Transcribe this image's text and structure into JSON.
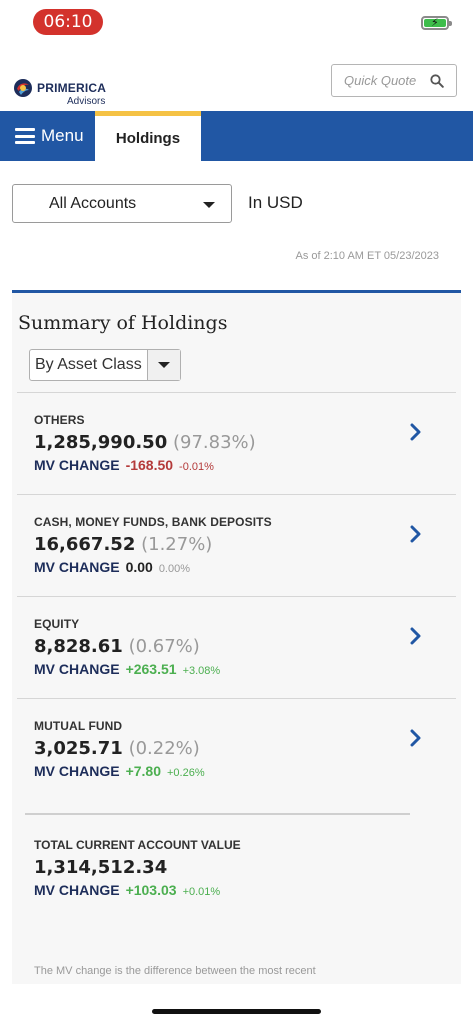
{
  "status": {
    "time": "06:10",
    "colors": {
      "time_pill": "#d3322c",
      "battery": "#3dbd4b"
    }
  },
  "header": {
    "logo_name": "PRIMERICA",
    "logo_sub": "Advisors",
    "quick_quote_placeholder": "Quick Quote"
  },
  "nav": {
    "menu_label": "Menu",
    "active_tab": "Holdings",
    "colors": {
      "bar": "#2157a4",
      "tab_accent": "#f5c245"
    }
  },
  "account": {
    "selected": "All Accounts",
    "currency": "In USD",
    "as_of": "As of  2:10 AM ET 05/23/2023"
  },
  "summary": {
    "title": "Summary of Holdings",
    "group_by": "By Asset Class",
    "holdings": [
      {
        "name": "OTHERS",
        "value": "1,285,990.50",
        "pct": "(97.83%)",
        "mv_label": "MV CHANGE",
        "mv_amount": "-168.50",
        "mv_pct": "-0.01%",
        "trend": "neg"
      },
      {
        "name": "CASH, MONEY FUNDS, BANK DEPOSITS",
        "value": "16,667.52",
        "pct": "(1.27%)",
        "mv_label": "MV CHANGE",
        "mv_amount": "0.00",
        "mv_pct": "0.00%",
        "trend": "zero"
      },
      {
        "name": "EQUITY",
        "value": "8,828.61",
        "pct": "(0.67%)",
        "mv_label": "MV CHANGE",
        "mv_amount": "+263.51",
        "mv_pct": "+3.08%",
        "trend": "pos"
      },
      {
        "name": "MUTUAL FUND",
        "value": "3,025.71",
        "pct": "(0.22%)",
        "mv_label": "MV CHANGE",
        "mv_amount": "+7.80",
        "mv_pct": "+0.26%",
        "trend": "pos"
      }
    ],
    "total": {
      "label": "TOTAL CURRENT ACCOUNT VALUE",
      "value": "1,314,512.34",
      "mv_label": "MV CHANGE",
      "mv_amount": "+103.03",
      "mv_pct": "+0.01%"
    },
    "footnote": "The MV change is the difference between the most recent"
  }
}
